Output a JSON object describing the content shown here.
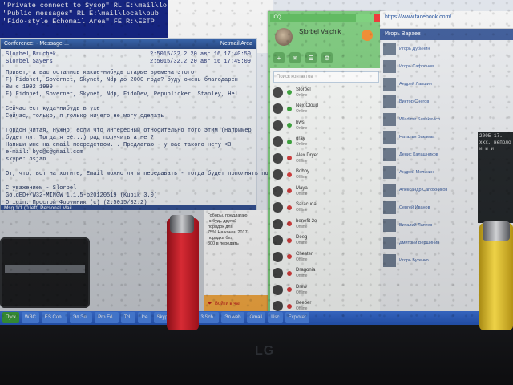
{
  "top_console": {
    "lines": [
      "\"Private connect to Sysop\" RL E:\\mail\\lo",
      "\"Public messages\" RL E:\\mail\\local\\pub",
      "\"Fido-style Echomail Area\" FE R:\\ESTP"
    ]
  },
  "reader": {
    "title_left": "Conference: - Message-...",
    "title_right": "Netmail Area",
    "header_rows": [
      {
        "left": "Slorbel Bruchek",
        "right": "2:5015/32.2  20 авг 16 17:40:50"
      },
      {
        "left": "Slorbel Sayers",
        "right": "2:5015/32.2  20 авг 16 17:49:09"
      }
    ],
    "body_lines": [
      "Привет, а вас остались какие-нибудь старые времена этого",
      "F) Fidonet, Sovernet, Skynet, Ndp до 2000 года? буду очень благодарен",
      "Вы с 1992 1999",
      "F) Fidonet, Sovernet, Skynet, Ndp, FidoDev, Republicker, Stanley, Hel",
      "",
      "Сейчас ест куда-нибудь в ухе",
      "Сейчас, только, я только ничего не могу сделать",
      "",
      "Гордон читая, нужно, если что интересный относительно того этим (например",
      "будет ли. Тогда я её...) рад получить а не ?",
      "Напиши мне на email посредством... Предлагаю - у вас такого нету <3",
      "e-mail: byd@s@gmail.com",
      "skype: bsjan",
      "",
      "От, что, вот на хотите, Email можно ли и передавать - тогда будет пополнять по ftp или",
      "",
      "С уважением - Slorbel",
      "GoldED+/W32-MINGW 1.1.5-b20120519 (Kubik 3.0)",
      "Origin: Простой Форумник (c) (2:5015/32.2)"
    ],
    "status": "Msg 1/1  (0 left)  Personal Mail"
  },
  "mid_panel": {
    "lines": [
      "Гоборы, предлагаю",
      "нибудь другой",
      "порядок для",
      "75% На конец 2017",
      "порядка без",
      "300 в передать"
    ],
    "button_label": "Войти в чат"
  },
  "messenger": {
    "app_label": "ICQ",
    "user_name": "Slorbel Vaichik",
    "search_placeholder": "Поиск контактов",
    "contacts": [
      {
        "name": "Slorbel",
        "sub": "Online",
        "status": "#3aa43a"
      },
      {
        "name": "NextCloud",
        "sub": "Online",
        "status": "#3aa43a"
      },
      {
        "name": "bws",
        "sub": "Online",
        "status": "#3aa43a"
      },
      {
        "name": "gray",
        "sub": "Online",
        "status": "#3aa43a"
      },
      {
        "name": "Alex Dryer",
        "sub": "Offline",
        "status": "#d63c3c"
      },
      {
        "name": "Bobby",
        "sub": "Offline",
        "status": "#d63c3c"
      },
      {
        "name": "Maya",
        "sub": "Offline",
        "status": "#d63c3c"
      },
      {
        "name": "Saracuda",
        "sub": "Offline",
        "status": "#d63c3c"
      },
      {
        "name": "benefit 2e",
        "sub": "Offline",
        "status": "#d63c3c"
      },
      {
        "name": "Deeg",
        "sub": "Offline",
        "status": "#d63c3c"
      },
      {
        "name": "Chester",
        "sub": "Offline",
        "status": "#d63c3c"
      },
      {
        "name": "Dragonia",
        "sub": "Offline",
        "status": "#d63c3c"
      },
      {
        "name": "Drew",
        "sub": "Offline",
        "status": "#d63c3c"
      },
      {
        "name": "Beeper",
        "sub": "Offline",
        "status": "#d63c3c"
      },
      {
        "name": "Burna",
        "sub": "Offline",
        "status": "#d63c3c"
      }
    ]
  },
  "facebook": {
    "url": "https://www.facebook.com/",
    "header": "Игорь Вараев",
    "people": [
      "Игорь Дубинин",
      "Игорь Сафронов",
      "Андрей Лапшин",
      "Виктор Снегов",
      "Wladimir Sushkevich",
      "Наталья Бакаева",
      "Денис Калашников",
      "Андрей Мелькин",
      "Александр Сапожников",
      "Сергей Иванов",
      "Виталий Лаптев",
      "Дмитрий Вершинин",
      "Игорь Бутенко"
    ],
    "dark_lines": [
      "2005 17.",
      "ххх, неполо",
      "и и и"
    ]
  },
  "taskbar": {
    "items": [
      "Пуск",
      "WBC",
      "ES Con..",
      "Эл Эл..",
      "Pro Ed..",
      "Tcl..",
      "Ice",
      "Skype..",
      "A file",
      "3 Sch..",
      "Эл web",
      "Gmail",
      "Usc",
      "Explorer"
    ]
  },
  "monitor": {
    "brand": "LG"
  }
}
